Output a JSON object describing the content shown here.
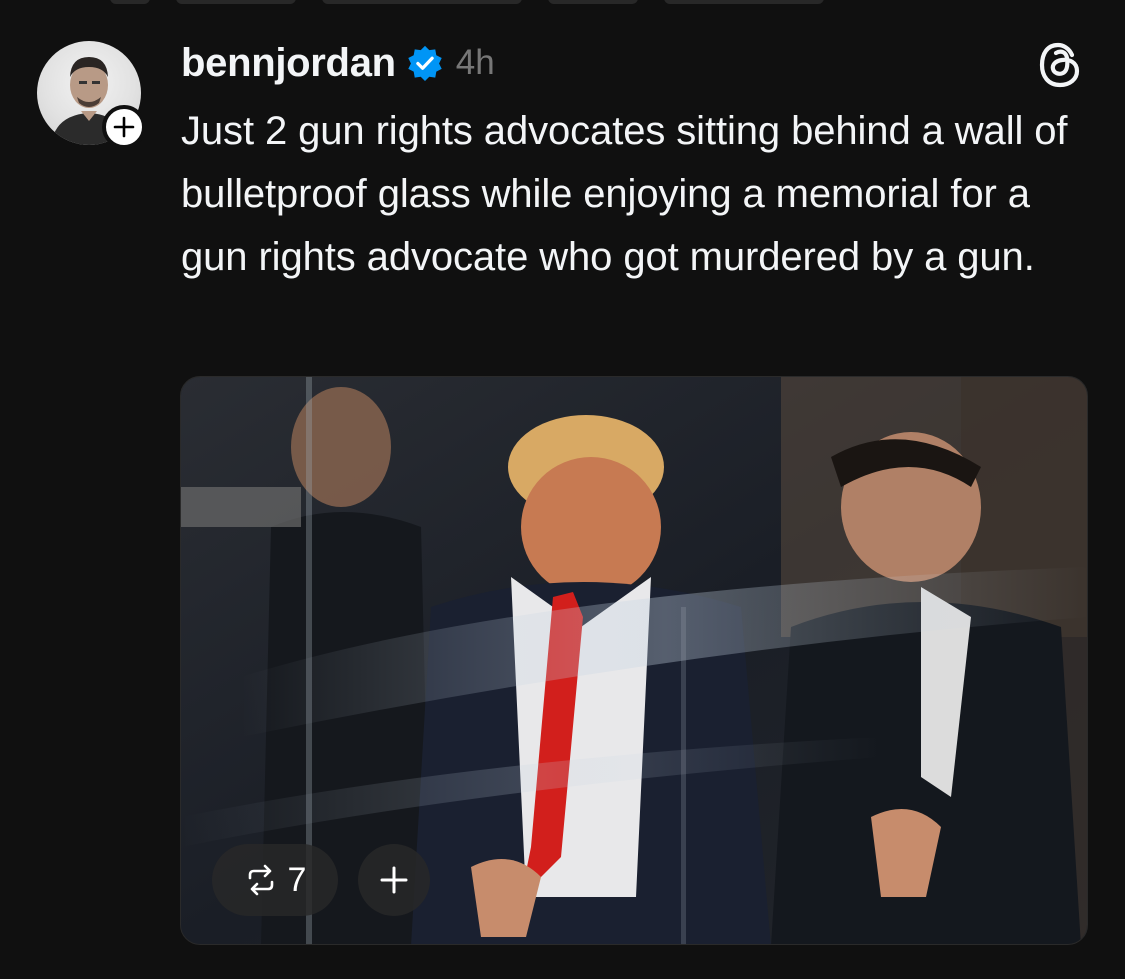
{
  "post": {
    "username": "bennjordan",
    "timestamp": "4h",
    "text": "Just 2 gun rights advocates sitting behind a wall of bulletproof glass while enjoying a memorial for a gun rights advocate who got murdered by a gun.",
    "verified": true
  },
  "media": {
    "repost_count": "7",
    "repost_icon": "repost-icon",
    "add_icon": "plus-icon"
  },
  "icons": {
    "app_logo": "threads-logo-icon",
    "verified": "verified-badge-icon",
    "follow": "plus-icon"
  },
  "colors": {
    "background": "#101010",
    "text": "#f3f5f7",
    "muted": "#777777",
    "verified_blue": "#0095f6"
  }
}
